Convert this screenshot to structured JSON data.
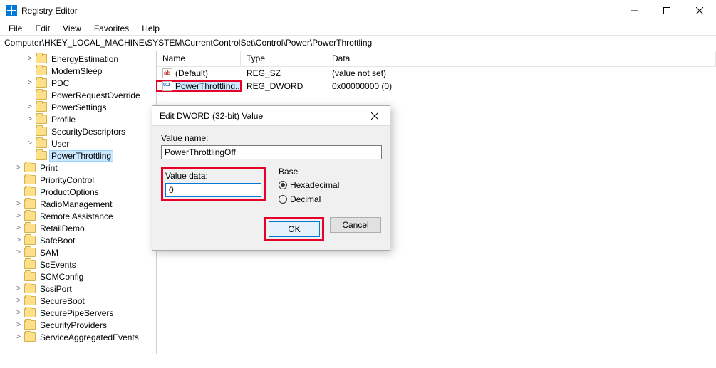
{
  "window": {
    "title": "Registry Editor"
  },
  "menu": {
    "file": "File",
    "edit": "Edit",
    "view": "View",
    "favorites": "Favorites",
    "help": "Help"
  },
  "address": "Computer\\HKEY_LOCAL_MACHINE\\SYSTEM\\CurrentControlSet\\Control\\Power\\PowerThrottling",
  "tree": {
    "items": [
      {
        "label": "EnergyEstimation",
        "depth": 2,
        "exp": ">"
      },
      {
        "label": "ModernSleep",
        "depth": 2,
        "exp": ""
      },
      {
        "label": "PDC",
        "depth": 2,
        "exp": ">"
      },
      {
        "label": "PowerRequestOverride",
        "depth": 2,
        "exp": ""
      },
      {
        "label": "PowerSettings",
        "depth": 2,
        "exp": ">"
      },
      {
        "label": "Profile",
        "depth": 2,
        "exp": ">"
      },
      {
        "label": "SecurityDescriptors",
        "depth": 2,
        "exp": ""
      },
      {
        "label": "User",
        "depth": 2,
        "exp": ">"
      },
      {
        "label": "PowerThrottling",
        "depth": 2,
        "exp": "",
        "selected": true
      },
      {
        "label": "Print",
        "depth": 1,
        "exp": ">"
      },
      {
        "label": "PriorityControl",
        "depth": 1,
        "exp": ""
      },
      {
        "label": "ProductOptions",
        "depth": 1,
        "exp": ""
      },
      {
        "label": "RadioManagement",
        "depth": 1,
        "exp": ">"
      },
      {
        "label": "Remote Assistance",
        "depth": 1,
        "exp": ">"
      },
      {
        "label": "RetailDemo",
        "depth": 1,
        "exp": ">"
      },
      {
        "label": "SafeBoot",
        "depth": 1,
        "exp": ">"
      },
      {
        "label": "SAM",
        "depth": 1,
        "exp": ">"
      },
      {
        "label": "ScEvents",
        "depth": 1,
        "exp": ""
      },
      {
        "label": "SCMConfig",
        "depth": 1,
        "exp": ""
      },
      {
        "label": "ScsiPort",
        "depth": 1,
        "exp": ">"
      },
      {
        "label": "SecureBoot",
        "depth": 1,
        "exp": ">"
      },
      {
        "label": "SecurePipeServers",
        "depth": 1,
        "exp": ">"
      },
      {
        "label": "SecurityProviders",
        "depth": 1,
        "exp": ">"
      },
      {
        "label": "ServiceAggregatedEvents",
        "depth": 1,
        "exp": ">"
      }
    ]
  },
  "list": {
    "col_name": "Name",
    "col_type": "Type",
    "col_data": "Data",
    "rows": [
      {
        "name": "(Default)",
        "type": "REG_SZ",
        "data": "(value not set)",
        "icon": "sz"
      },
      {
        "name": "PowerThrottling...",
        "type": "REG_DWORD",
        "data": "0x00000000 (0)",
        "icon": "dw",
        "selected": true,
        "highlight": true
      }
    ]
  },
  "dialog": {
    "title": "Edit DWORD (32-bit) Value",
    "value_name_label": "Value name:",
    "value_name": "PowerThrottlingOff",
    "value_data_label": "Value data:",
    "value_data": "0",
    "base_label": "Base",
    "hex_label": "Hexadecimal",
    "dec_label": "Decimal",
    "base_selected": "hex",
    "ok": "OK",
    "cancel": "Cancel"
  }
}
